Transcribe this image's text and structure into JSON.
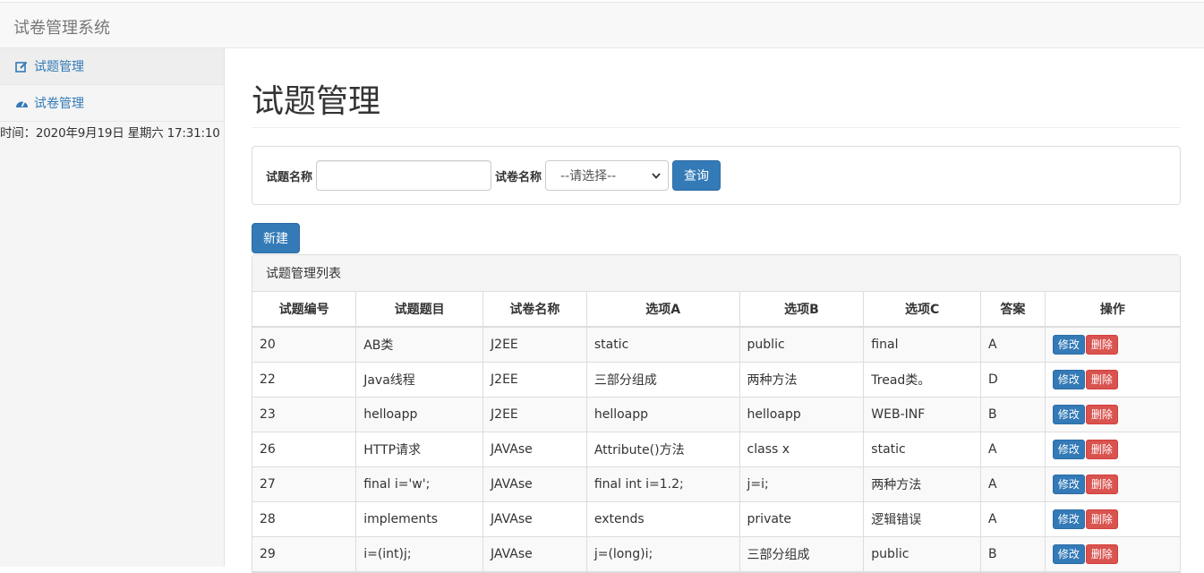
{
  "app": {
    "title": "试卷管理系统"
  },
  "sidebar": {
    "items": [
      {
        "label": "试题管理",
        "icon": "edit-icon"
      },
      {
        "label": "试卷管理",
        "icon": "dashboard-icon"
      }
    ],
    "clock": "时间：2020年9月19日 星期六 17:31:10"
  },
  "page": {
    "title": "试题管理"
  },
  "search": {
    "question_label": "试题名称",
    "question_value": "",
    "paper_label": "试卷名称",
    "paper_selected": "--请选择--",
    "query_button": "查询"
  },
  "actions": {
    "new_button": "新建"
  },
  "table": {
    "panel_title": "试题管理列表",
    "headers": [
      "试题编号",
      "试题题目",
      "试卷名称",
      "选项A",
      "选项B",
      "选项C",
      "答案",
      "操作"
    ],
    "edit_label": "修改",
    "delete_label": "删除",
    "rows": [
      [
        "20",
        "AB类",
        "J2EE",
        "static",
        "public",
        "final",
        "A"
      ],
      [
        "22",
        "Java线程",
        "J2EE",
        "三部分组成",
        "两种方法",
        "Tread类。",
        "D"
      ],
      [
        "23",
        "helloapp",
        "J2EE",
        "helloapp",
        "helloapp",
        "WEB-INF",
        "B"
      ],
      [
        "26",
        "HTTP请求",
        "JAVAse",
        "Attribute()方法",
        "class x",
        "static",
        "A"
      ],
      [
        "27",
        "final i='w';",
        "JAVAse",
        "final int i=1.2;",
        "j=i;",
        "两种方法",
        "A"
      ],
      [
        "28",
        "implements",
        "JAVAse",
        "extends",
        "private",
        "逻辑错误",
        "A"
      ],
      [
        "29",
        "i=(int)j;",
        "JAVAse",
        "j=(long)i;",
        "三部分组成",
        "public",
        "B"
      ]
    ]
  },
  "colors": {
    "primary": "#337ab7",
    "danger": "#d9534f",
    "navbar": "#f8f8f8"
  }
}
